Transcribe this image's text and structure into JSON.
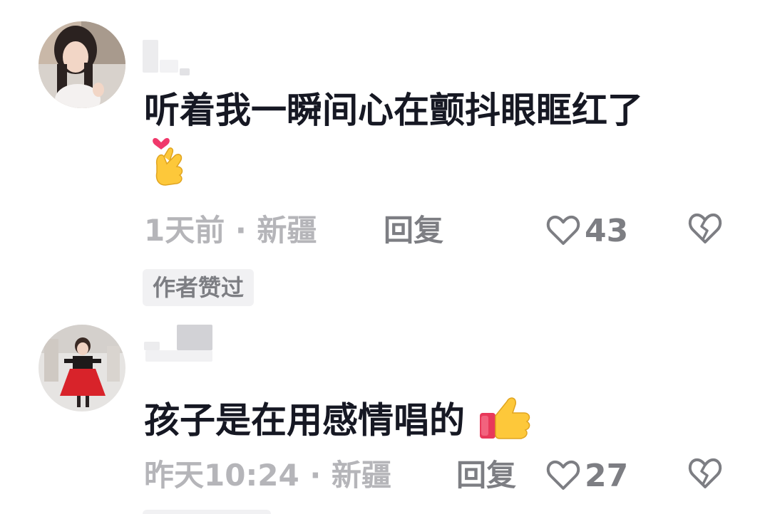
{
  "comments": [
    {
      "text": "听着我一瞬间心在颤抖眼眶红了",
      "emoji": "finger-heart-emoji",
      "time_location": "1天前 · 新疆",
      "reply_label": "回复",
      "likes": "43",
      "badge": "作者赞过"
    },
    {
      "text": "孩子是在用感情唱的",
      "emoji": "thumbs-up-emoji",
      "time_location": "昨天10:24 · 新疆",
      "reply_label": "回复",
      "likes": "27"
    }
  ],
  "colors": {
    "text_primary": "#161823",
    "text_secondary": "#7d7e83",
    "text_muted": "#b5b5b9",
    "badge_bg": "#f1f1f3"
  }
}
